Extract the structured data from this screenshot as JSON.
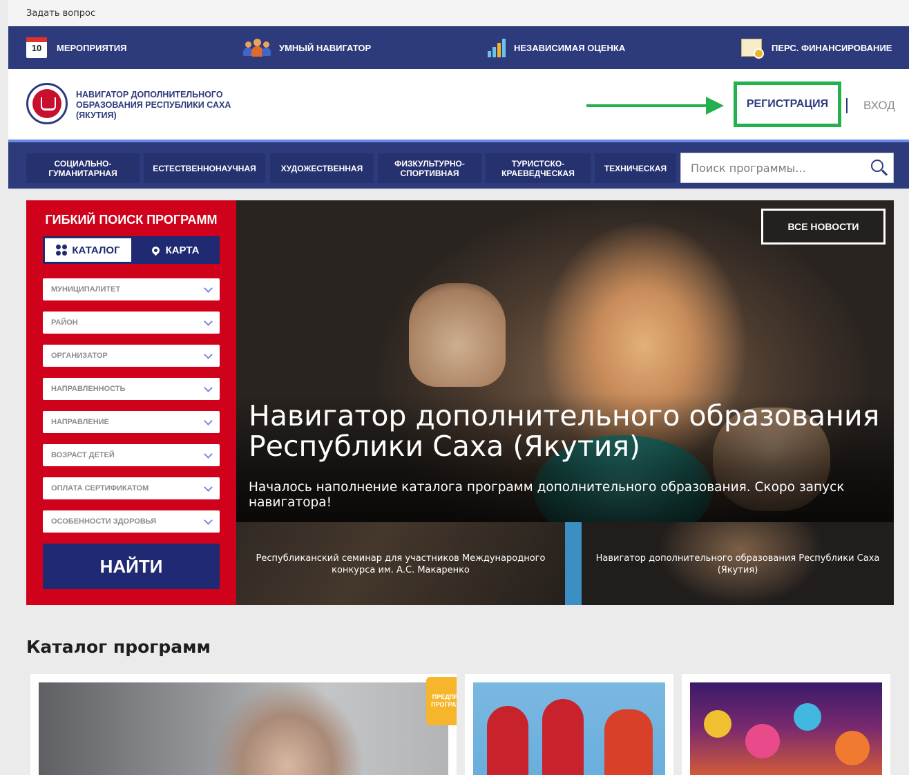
{
  "ask_link": "Задать вопрос",
  "topnav": {
    "calendar_day": "10",
    "events": "МЕРОПРИЯТИЯ",
    "smart_navigator": "УМНЫЙ НАВИГАТОР",
    "independent_rating": "НЕЗАВИСИМАЯ ОЦЕНКА",
    "personal_funding": "ПЕРС. ФИНАНСИРОВАНИЕ"
  },
  "header": {
    "brand": "НАВИГАТОР ДОПОЛНИТЕЛЬНОГО ОБРАЗОВАНИЯ РЕСПУБЛИКИ САХА (ЯКУТИЯ)",
    "register": "РЕГИСТРАЦИЯ",
    "login": "ВХОД",
    "accent_color": "#22b14c"
  },
  "categories": [
    "СОЦИАЛЬНО-ГУМАНИТАРНАЯ",
    "ЕСТЕСТВЕННОНАУЧНАЯ",
    "ХУДОЖЕСТВЕННАЯ",
    "ФИЗКУЛЬТУРНО-СПОРТИВНАЯ",
    "ТУРИСТСКО-КРАЕВЕДЧЕСКАЯ",
    "ТЕХНИЧЕСКАЯ"
  ],
  "search": {
    "placeholder": "Поиск программы..."
  },
  "filter": {
    "title": "ГИБКИЙ ПОИСК ПРОГРАММ",
    "tab_catalog": "КАТАЛОГ",
    "tab_map": "КАРТА",
    "selects": [
      "МУНИЦИПАЛИТЕТ",
      "РАЙОН",
      "ОРГАНИЗАТОР",
      "НАПРАВЛЕННОСТЬ",
      "НАПРАВЛЕНИЕ",
      "ВОЗРАСТ ДЕТЕЙ",
      "ОПЛАТА СЕРТИФИКАТОМ",
      "ОСОБЕННОСТИ ЗДОРОВЬЯ"
    ],
    "find": "НАЙТИ"
  },
  "hero": {
    "all_news": "ВСЕ НОВОСТИ",
    "title": "Навигатор дополнительного образования Республики Саха (Якутия)",
    "subtitle": "Началось наполнение каталога программ дополнительного образования. Скоро запуск навигатора!"
  },
  "news": [
    "Республиканский семинар для участников Международного конкурса им. А.С. Макаренко",
    "Навигатор дополнительного образования Республики Саха (Якутия)"
  ],
  "catalog": {
    "title": "Каталог программ",
    "badge": "ПРЕДПРОФ. ПРОГРАММА"
  },
  "colors": {
    "navy": "#2d3a7c",
    "red": "#d0021b",
    "badge": "#f6b52a"
  }
}
